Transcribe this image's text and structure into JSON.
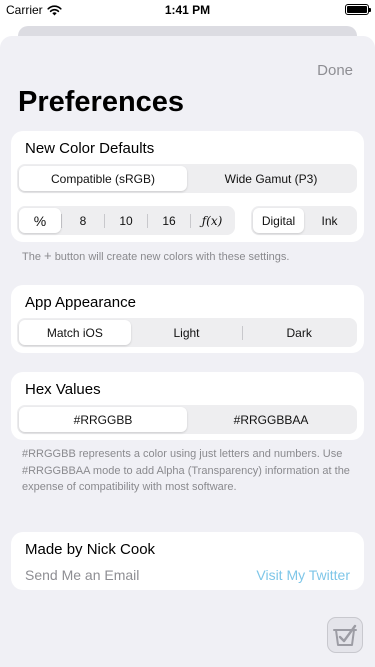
{
  "status_bar": {
    "carrier": "Carrier",
    "time": "1:41 PM",
    "battery_level": 1.0
  },
  "header": {
    "done_label": "Done",
    "title": "Preferences"
  },
  "new_color_defaults": {
    "title": "New Color Defaults",
    "gamut_options": [
      "Compatible (sRGB)",
      "Wide Gamut (P3)"
    ],
    "gamut_selected": "Compatible (sRGB)",
    "format_options": [
      "%",
      "8",
      "10",
      "16",
      "ƒ(x)"
    ],
    "format_selected": "%",
    "mode_options": [
      "Digital",
      "Ink"
    ],
    "mode_selected": "Digital",
    "footnote_pre": "The",
    "footnote_post": "button will create new colors with these settings."
  },
  "app_appearance": {
    "title": "App Appearance",
    "options": [
      "Match iOS",
      "Light",
      "Dark"
    ],
    "selected": "Match iOS"
  },
  "hex_values": {
    "title": "Hex Values",
    "options": [
      "#RRGGBB",
      "#RRGGBBAA"
    ],
    "selected": "#RRGGBB",
    "footnote": "#RRGGBB represents a color using just letters and numbers. Use #RRGGBBAA mode to add Alpha (Transparency) information at the expense of compatibility with most software."
  },
  "about": {
    "title": "Made by Nick Cook",
    "email_label": "Send Me an Email",
    "twitter_label": "Visit My Twitter"
  },
  "colors": {
    "twitter_link": "#7ec6e8",
    "muted": "#8e8e93",
    "sheet_bg": "#f0f0f5"
  },
  "icons": {
    "wifi": "wifi-icon",
    "battery": "battery-icon",
    "plus": "plus-icon",
    "app": "app-icon"
  }
}
